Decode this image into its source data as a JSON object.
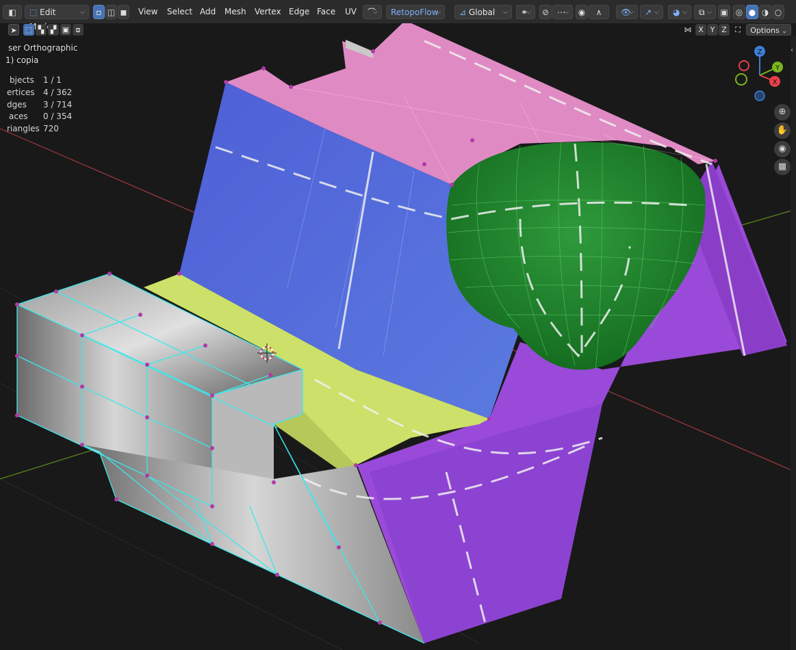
{
  "header": {
    "mode": "Edit Mode",
    "menus": [
      "View",
      "Select",
      "Add",
      "Mesh",
      "Vertex",
      "Edge",
      "Face",
      "UV"
    ],
    "addon": "RetopoFlow",
    "orientation": "Global",
    "options": "Options",
    "axes": [
      "X",
      "Y",
      "Z"
    ]
  },
  "overlay": {
    "view_name": "ser Orthographic",
    "object_name": "1) copia",
    "stats": [
      {
        "label": "bjects",
        "value": "1 / 1"
      },
      {
        "label": "ertices",
        "value": "4 / 362"
      },
      {
        "label": "dges",
        "value": "3 / 714"
      },
      {
        "label": "aces",
        "value": "0 / 354"
      },
      {
        "label": "riangles",
        "value": "720"
      }
    ]
  },
  "gizmo": {
    "z": "Z",
    "y": "Y",
    "x": "X"
  },
  "colors": {
    "header_bg": "#2b2b2b",
    "viewport_bg": "#191919",
    "selection": "#4772b3",
    "face_pink": "#e08ac4",
    "face_blue": "#5864d2",
    "face_green": "#2e8f3a",
    "face_yellow": "#cde06a",
    "face_purple": "#9a4ad8",
    "wire_cyan": "#3ce8ea",
    "vertex": "#b03aa6",
    "axis_red": "#e8404a",
    "axis_green": "#7ab51f",
    "axis_blue": "#3c7fd8"
  },
  "icons": [
    "cursor-icon",
    "box-select-icon",
    "vertex-mode-icon",
    "edge-mode-icon",
    "face-mode-icon",
    "snap-icon",
    "proportional-icon",
    "visibility-icon",
    "gizmo-icon",
    "overlay-icon",
    "xray-icon",
    "shading-wire-icon",
    "shading-solid-icon",
    "shading-material-icon",
    "shading-render-icon",
    "zoom-icon",
    "hand-icon",
    "camera-icon",
    "grid-icon"
  ]
}
